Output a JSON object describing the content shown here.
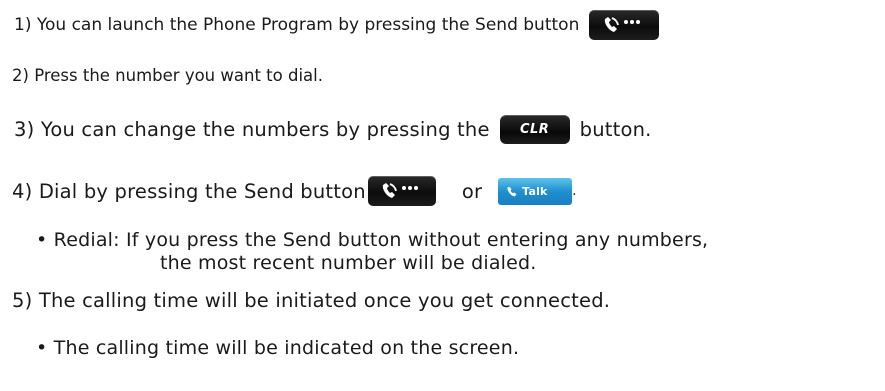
{
  "steps": [
    {
      "number": "1)",
      "text": "You can launch the Phone Program by pressing the Send button"
    },
    {
      "number": "2)",
      "text": "Press the number you want to dial."
    },
    {
      "number": "3)",
      "text_before": "You can change the numbers by pressing the",
      "text_after": "button."
    },
    {
      "number": "4)",
      "text_before": "Dial by pressing the Send button",
      "text_middle": "or",
      "text_after": "."
    },
    {
      "number": "5)",
      "text": "The calling time will be initiated once you get connected."
    }
  ],
  "bullets": {
    "redial_line1": "• Redial: If you press the Send button without entering any numbers,",
    "redial_line2": "the most recent number will be dialed.",
    "calling_time": "• The calling time will be indicated on the screen."
  },
  "buttons": {
    "send_icon": "phone-send-icon",
    "clr_label": "CLR",
    "talk_label": "Talk",
    "talk_icon": "handset-icon"
  },
  "colors": {
    "button_dark": "#111111",
    "talk_blue": "#1f8fd0",
    "text": "#1a1a1a"
  }
}
